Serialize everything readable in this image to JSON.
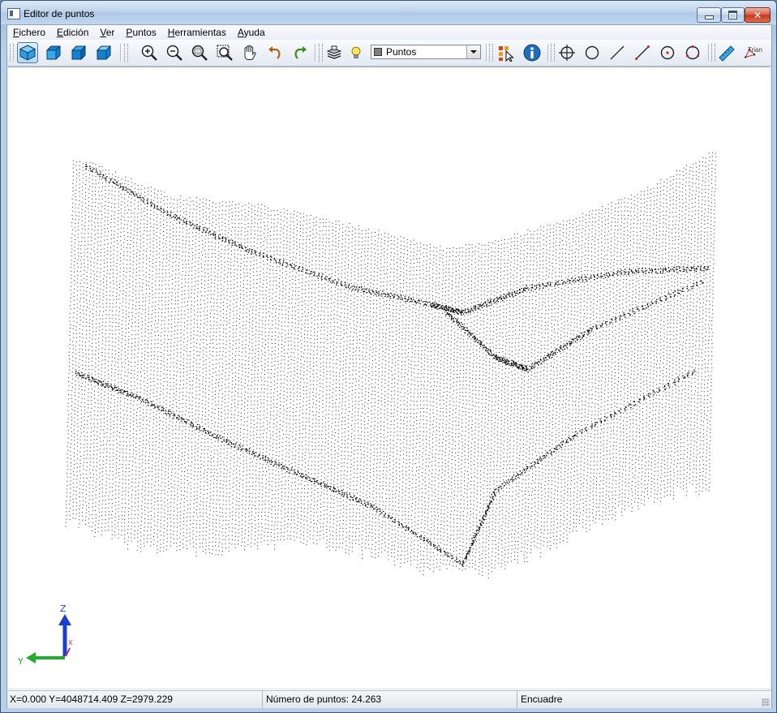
{
  "window": {
    "title": "Editor de puntos"
  },
  "menu": [
    {
      "label": "Fichero",
      "mnemonic": "F",
      "rest": "ichero"
    },
    {
      "label": "Edición",
      "mnemonic": "E",
      "rest": "dición"
    },
    {
      "label": "Ver",
      "mnemonic": "V",
      "rest": "er"
    },
    {
      "label": "Puntos",
      "mnemonic": "P",
      "rest": "untos"
    },
    {
      "label": "Herramientas",
      "mnemonic": "H",
      "rest": "erramientas"
    },
    {
      "label": "Ayuda",
      "mnemonic": "A",
      "rest": "yuda"
    }
  ],
  "toolbar": {
    "view_buttons": [
      "view-3d-icon",
      "view-front-icon",
      "view-side-icon",
      "view-top-icon"
    ],
    "nav_buttons": [
      "zoom-in-icon",
      "zoom-out-icon",
      "zoom-window-icon",
      "zoom-extents-icon",
      "pan-hand-icon",
      "undo-icon",
      "redo-icon"
    ],
    "layer": {
      "value": "Puntos",
      "swatch_color": "#808080"
    },
    "draw_buttons": [
      "crosshair-icon",
      "circle-icon",
      "line-icon",
      "line-points-icon",
      "circle-center-icon",
      "circle-points-icon",
      "ruler-icon",
      "triangulate-icon"
    ],
    "triangulate_label": "Trian"
  },
  "axes": {
    "z_label": "Z",
    "y_label": "Y",
    "x_label": "X"
  },
  "status": {
    "coords": "X=0.000 Y=4048714.409 Z=2979.229",
    "point_count": "Número de puntos: 24.263",
    "mode": "Encuadre"
  },
  "colors": {
    "accent": "#1f6fb8",
    "points": "#000000",
    "axis_z": "#1a3fd0",
    "axis_y": "#1fae2a",
    "axis_x": "#c0306a"
  }
}
